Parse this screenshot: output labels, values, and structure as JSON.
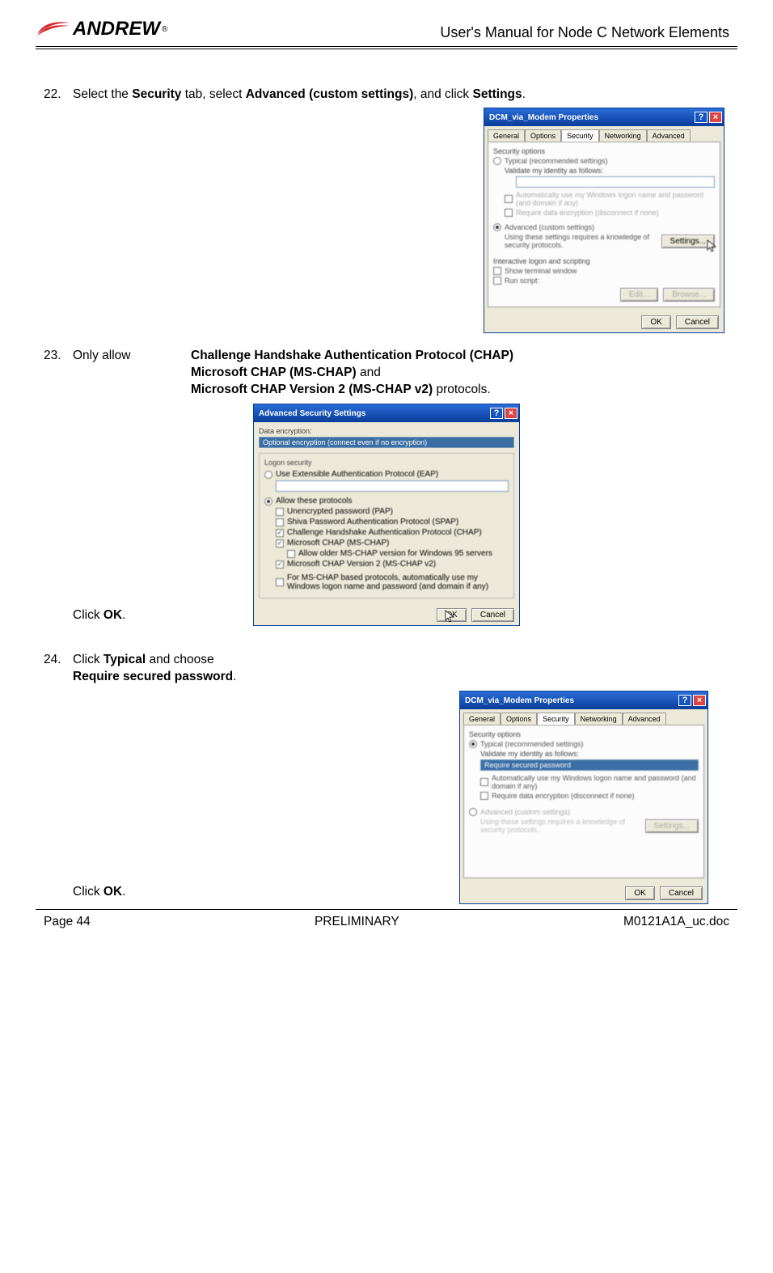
{
  "header": {
    "logo_text": "ANDREW",
    "title": "User's Manual for Node C Network Elements"
  },
  "steps": {
    "s22": {
      "num": "22.",
      "t1": "Select the ",
      "b1": "Security",
      "t2": " tab, select ",
      "b2": "Advanced (custom settings)",
      "t3": ", and click ",
      "b3": "Settings",
      "t4": "."
    },
    "s23": {
      "num": "23.",
      "lead": "Only allow ",
      "l1b": "Challenge Handshake Authentication Protocol (CHAP)",
      "l2b": "Microsoft CHAP (MS-CHAP)",
      "l2t": " and",
      "l3b": "Microsoft CHAP Version 2 (MS-CHAP v2)",
      "l3t": " protocols.",
      "click_pre": "Click ",
      "click_b": "OK",
      "click_post": "."
    },
    "s24": {
      "num": "24.",
      "t1": "Click ",
      "b1": "Typical",
      "t2": " and choose",
      "l2b": "Require secured password",
      "l2t": ".",
      "click_pre": "Click ",
      "click_b": "OK",
      "click_post": "."
    }
  },
  "dialog1": {
    "title": "DCM_via_Modem Properties",
    "tabs": [
      "General",
      "Options",
      "Security",
      "Networking",
      "Advanced"
    ],
    "sec_label": "Security options",
    "r_typical": "Typical (recommended settings)",
    "validate_label": "Validate my identity as follows:",
    "cb_auto": "Automatically use my Windows logon name and password (and domain if any)",
    "cb_require": "Require data encryption (disconnect if none)",
    "r_advanced": "Advanced (custom settings)",
    "adv_note": "Using these settings requires a knowledge of security protocols.",
    "settings_btn": "Settings...",
    "group_label": "Interactive logon and scripting",
    "cb_terminal": "Show terminal window",
    "cb_script": "Run script:",
    "edit_btn": "Edit...",
    "browse_btn": "Browse...",
    "ok": "OK",
    "cancel": "Cancel"
  },
  "dialog2": {
    "title": "Advanced Security Settings",
    "enc_label": "Data encryption:",
    "enc_val": "Optional encryption (connect even if no encryption)",
    "logon_label": "Logon security",
    "r_eap": "Use Extensible Authentication Protocol (EAP)",
    "r_allow": "Allow these protocols",
    "p_pap": "Unencrypted password (PAP)",
    "p_spap": "Shiva Password Authentication Protocol (SPAP)",
    "p_chap": "Challenge Handshake Authentication Protocol (CHAP)",
    "p_mschap": "Microsoft CHAP (MS-CHAP)",
    "p_older": "Allow older MS-CHAP version for Windows 95 servers",
    "p_mschap2": "Microsoft CHAP Version 2 (MS-CHAP v2)",
    "p_auto": "For MS-CHAP based protocols, automatically use my Windows logon name and password (and domain if any)",
    "ok": "OK",
    "cancel": "Cancel"
  },
  "dialog3": {
    "title": "DCM_via_Modem Properties",
    "tabs": [
      "General",
      "Options",
      "Security",
      "Networking",
      "Advanced"
    ],
    "sec_label": "Security options",
    "r_typical": "Typical (recommended settings)",
    "validate_label": "Validate my identity as follows:",
    "dropdown_val": "Require secured password",
    "cb_auto": "Automatically use my Windows logon name and password (and domain if any)",
    "cb_require": "Require data encryption (disconnect if none)",
    "r_advanced": "Advanced (custom settings)",
    "adv_note": "Using these settings requires a knowledge of security protocols.",
    "settings_btn": "Settings...",
    "ok": "OK",
    "cancel": "Cancel"
  },
  "footer": {
    "left": "Page 44",
    "center": "PRELIMINARY",
    "right": "M0121A1A_uc.doc"
  }
}
